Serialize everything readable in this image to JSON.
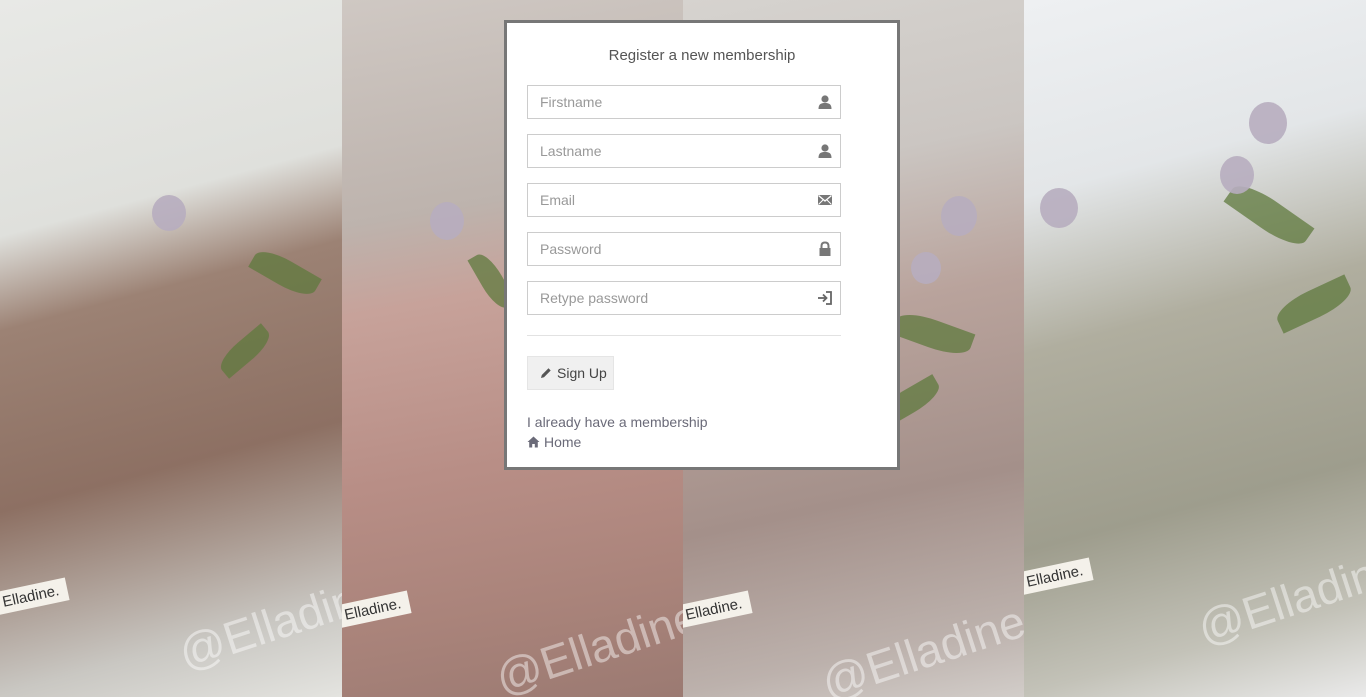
{
  "register": {
    "title": "Register a new membership",
    "fields": [
      {
        "placeholder": "Firstname",
        "value": "",
        "icon": "user-icon"
      },
      {
        "placeholder": "Lastname",
        "value": "",
        "icon": "user-icon"
      },
      {
        "placeholder": "Email",
        "value": "",
        "icon": "envelope-icon"
      },
      {
        "placeholder": "Password",
        "value": "",
        "icon": "lock-icon"
      },
      {
        "placeholder": "Retype password",
        "value": "",
        "icon": "login-icon"
      }
    ],
    "signup_label": "Sign Up",
    "membership_link": "I already have a membership",
    "home_link": "Home"
  },
  "background": {
    "brand_label": "Elladine.",
    "watermark": "@Elladine"
  },
  "colors": {
    "box_border": "#777777",
    "link": "#6a6a78",
    "button_bg": "#f0f0f0"
  }
}
